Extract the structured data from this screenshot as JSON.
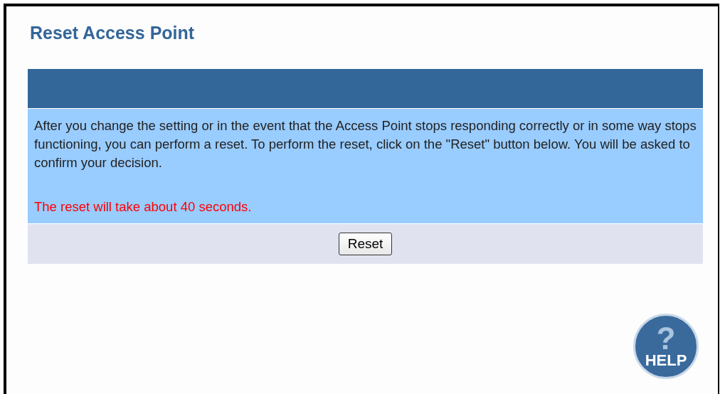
{
  "title": "Reset Access Point",
  "panel": {
    "description": "After you change the setting or in the event that the Access Point stops responding correctly or in some way stops functioning, you can perform a reset. To perform the reset, click on the \"Reset\" button below. You will be asked to confirm your decision.",
    "warning": "The reset will take about 40 seconds.",
    "button": "Reset"
  },
  "help": {
    "mark": "?",
    "label": "HELP"
  }
}
